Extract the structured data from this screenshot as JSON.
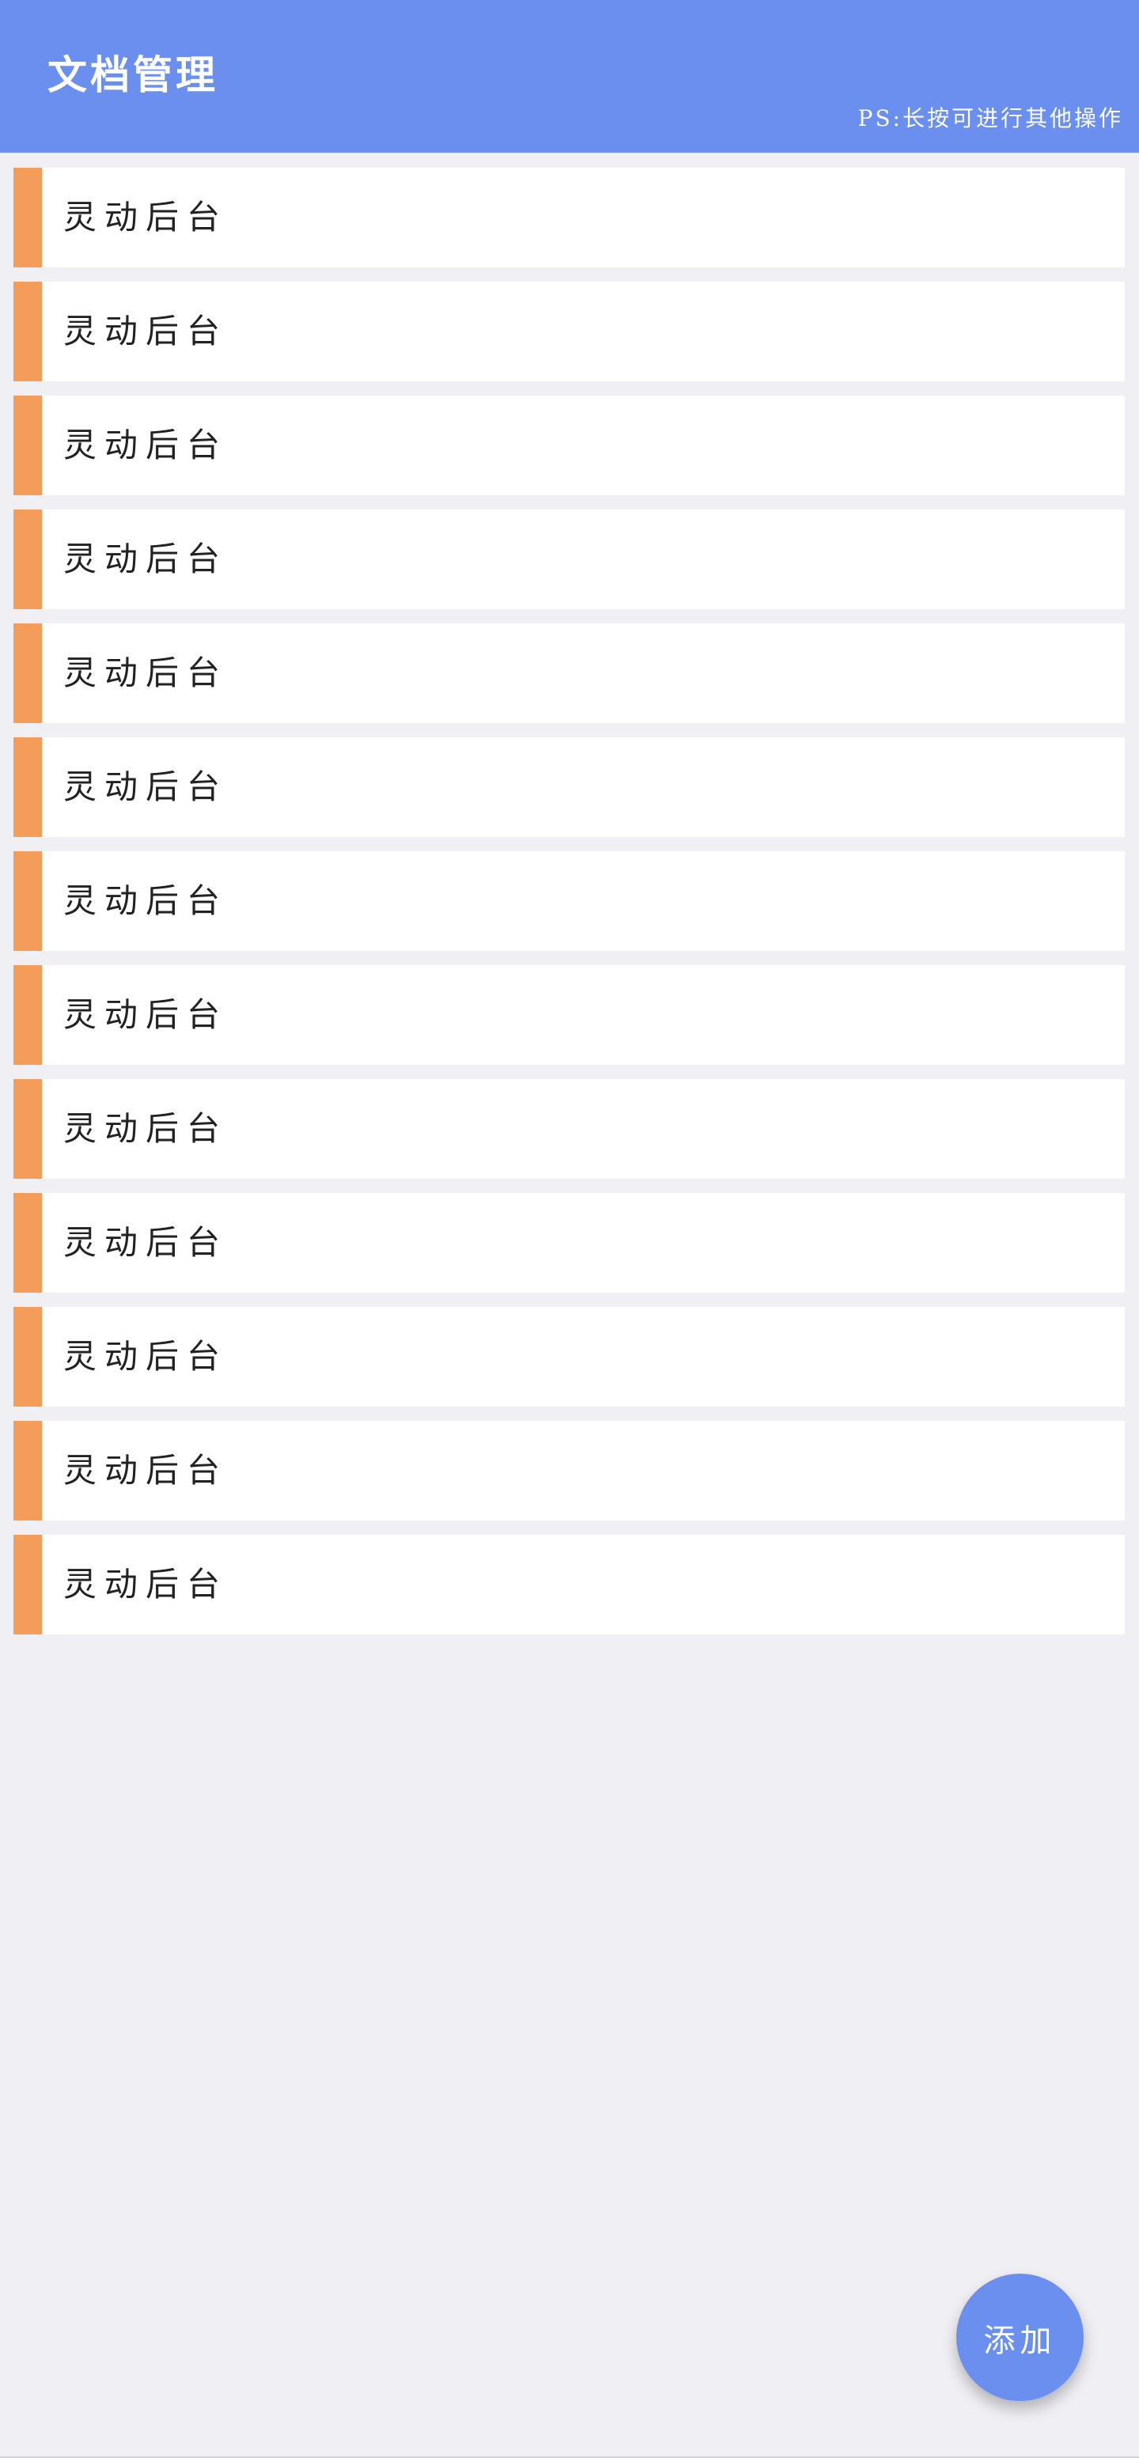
{
  "header": {
    "title": "文档管理",
    "hint": "PS:长按可进行其他操作"
  },
  "list": {
    "items": [
      {
        "label": "灵动后台"
      },
      {
        "label": "灵动后台"
      },
      {
        "label": "灵动后台"
      },
      {
        "label": "灵动后台"
      },
      {
        "label": "灵动后台"
      },
      {
        "label": "灵动后台"
      },
      {
        "label": "灵动后台"
      },
      {
        "label": "灵动后台"
      },
      {
        "label": "灵动后台"
      },
      {
        "label": "灵动后台"
      },
      {
        "label": "灵动后台"
      },
      {
        "label": "灵动后台"
      },
      {
        "label": "灵动后台"
      }
    ]
  },
  "fab": {
    "label": "添加"
  },
  "colors": {
    "header_bg": "#6b8fee",
    "accent_bar": "#f49d5b",
    "page_bg": "#efeff4",
    "fab_bg": "#6b8fee"
  }
}
